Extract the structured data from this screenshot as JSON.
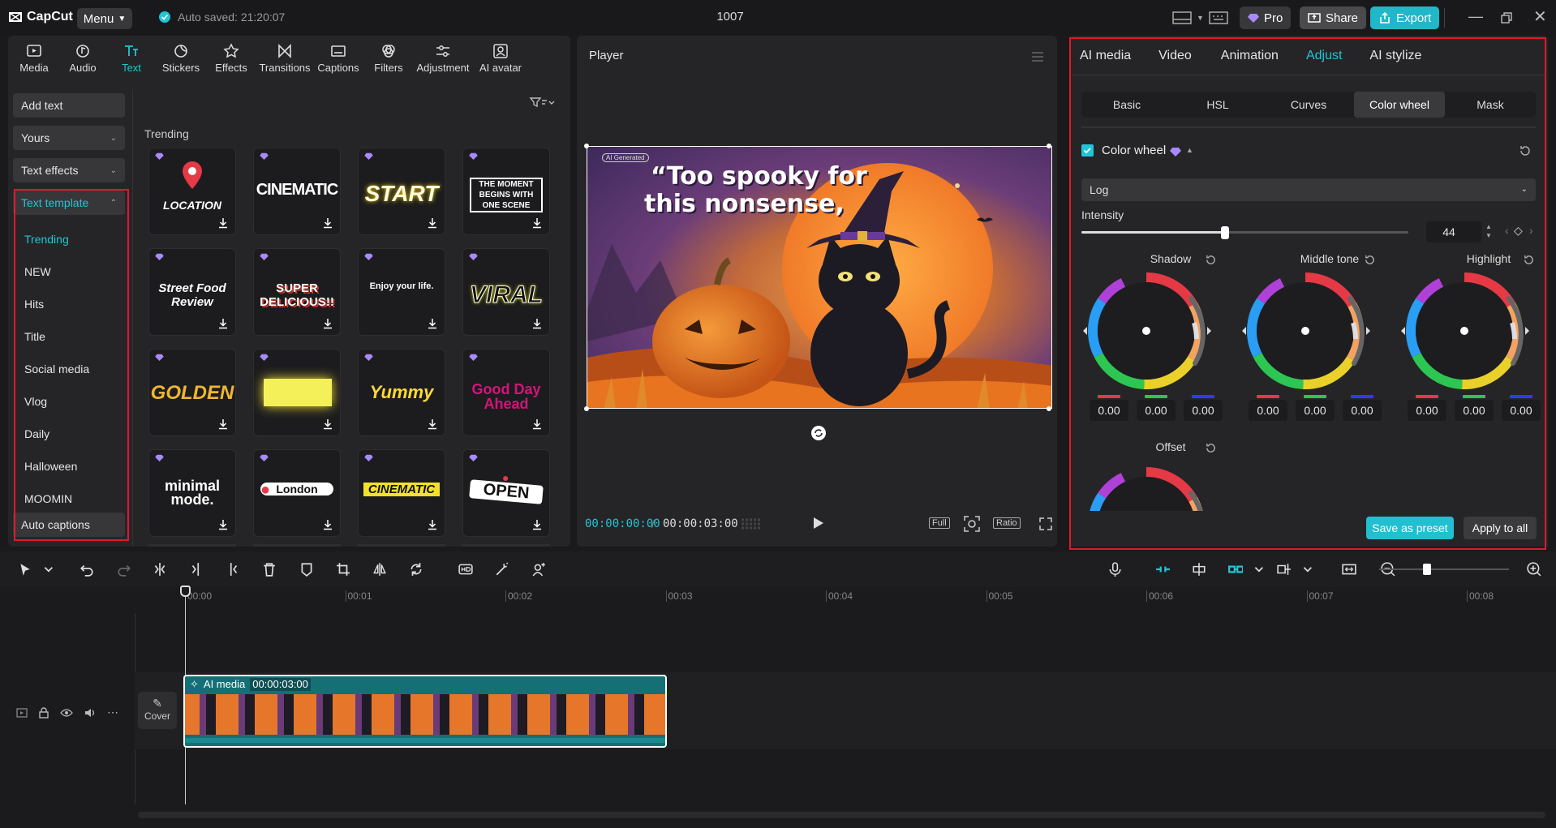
{
  "app": {
    "name": "CapCut",
    "menu_label": "Menu",
    "autosave": "Auto saved: 21:20:07",
    "project_title": "1007",
    "pro_label": "Pro",
    "share_label": "Share",
    "export_label": "Export"
  },
  "toolbar": [
    {
      "label": "Media",
      "icon": "media-icon"
    },
    {
      "label": "Audio",
      "icon": "audio-icon"
    },
    {
      "label": "Text",
      "icon": "text-icon",
      "active": true
    },
    {
      "label": "Stickers",
      "icon": "stickers-icon"
    },
    {
      "label": "Effects",
      "icon": "effects-icon"
    },
    {
      "label": "Transitions",
      "icon": "transitions-icon"
    },
    {
      "label": "Captions",
      "icon": "captions-icon"
    },
    {
      "label": "Filters",
      "icon": "filters-icon"
    },
    {
      "label": "Adjustment",
      "icon": "adjustment-icon"
    },
    {
      "label": "AI avatar",
      "icon": "ai-avatar-icon"
    }
  ],
  "sidebar": {
    "buttons": [
      {
        "label": "Add text"
      },
      {
        "label": "Yours"
      },
      {
        "label": "Text effects"
      },
      {
        "label": "Text template"
      }
    ],
    "items": [
      "Trending",
      "NEW",
      "Hits",
      "Title",
      "Social media",
      "Vlog",
      "Daily",
      "Halloween",
      "MOOMIN"
    ],
    "auto_captions": "Auto captions"
  },
  "templates": {
    "section": "Trending",
    "cards": [
      "LOCATION",
      "CINEMATIC",
      "START",
      "THE MOMENT BEGINS WITH ONE SCENE",
      "Street Food Review",
      "SUPER DELICIOUS!!",
      "Enjoy your life.",
      "VIRAL",
      "GOLDEN",
      "",
      "Yummy",
      "Good Day Ahead",
      "minimal mode.",
      "London",
      "CINEMATIC",
      "OPEN"
    ]
  },
  "player": {
    "title": "Player",
    "caption_line1": "“Too spooky for",
    "caption_line2": "this nonsense,",
    "watermark": "AI Generated",
    "time_current": "00:00:00:00",
    "time_total": "00:00:03:00",
    "full_label": "Full",
    "ratio_label": "Ratio"
  },
  "right_panel": {
    "tabs": [
      "AI media",
      "Video",
      "Animation",
      "Adjust",
      "AI stylize"
    ],
    "active_tab": "Adjust",
    "subtabs": [
      "Basic",
      "HSL",
      "Curves",
      "Color wheel",
      "Mask"
    ],
    "active_subtab": "Color wheel",
    "section_title": "Color wheel",
    "mode": "Log",
    "intensity_label": "Intensity",
    "intensity_value": "44",
    "intensity_fraction": 0.44,
    "wheels": [
      {
        "label": "Shadow",
        "r": "0.00",
        "g": "0.00",
        "b": "0.00"
      },
      {
        "label": "Middle tone",
        "r": "0.00",
        "g": "0.00",
        "b": "0.00"
      },
      {
        "label": "Highlight",
        "r": "0.00",
        "g": "0.00",
        "b": "0.00"
      }
    ],
    "offset_label": "Offset",
    "save_preset": "Save as preset",
    "apply_all": "Apply to all"
  },
  "timeline": {
    "ticks": [
      "00:00",
      "00:01",
      "00:02",
      "00:03",
      "00:04",
      "00:05",
      "00:06",
      "00:07",
      "00:08"
    ],
    "clip_label": "AI media",
    "clip_duration": "00:00:03:00",
    "cover_label": "Cover"
  },
  "colors": {
    "accent": "#22c5d5",
    "highlight_box": "#e0182d",
    "panel": "#252527"
  }
}
